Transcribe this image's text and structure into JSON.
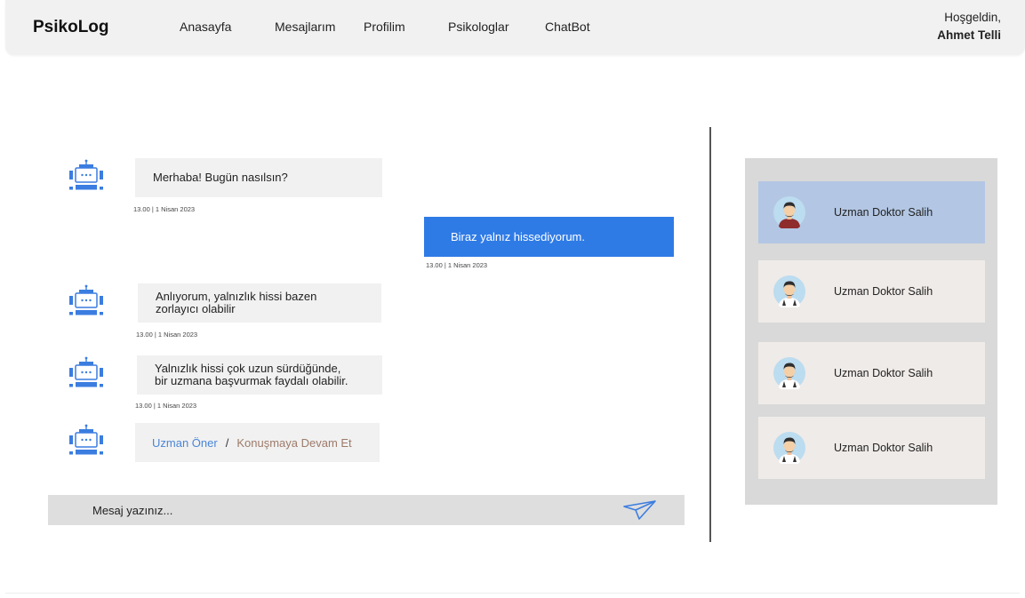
{
  "header": {
    "brand": "PsikoLog",
    "nav": [
      {
        "label": "Anasayfa"
      },
      {
        "label": "Mesajlarım"
      },
      {
        "label": "Profilim"
      },
      {
        "label": "Psikologlar"
      },
      {
        "label": "ChatBot"
      }
    ],
    "greeting": "Hoşgeldin,",
    "user_name": "Ahmet Telli"
  },
  "chat": {
    "messages": [
      {
        "sender": "bot",
        "text": "Merhaba! Bugün nasılsın?",
        "timestamp": "13.00 | 1 Nisan 2023"
      },
      {
        "sender": "user",
        "text": "Biraz yalnız hissediyorum.",
        "timestamp": "13.00 | 1 Nisan 2023"
      },
      {
        "sender": "bot",
        "text_line1": "Anlıyorum, yalnızlık hissi bazen",
        "text_line2": "zorlayıcı olabilir",
        "timestamp": "13.00 | 1 Nisan 2023"
      },
      {
        "sender": "bot",
        "text_line1": "Yalnızlık hissi çok uzun sürdüğünde,",
        "text_line2": "bir uzmana başvurmak faydalı olabilir.",
        "timestamp": "13.00 | 1 Nisan 2023"
      }
    ],
    "actions": {
      "suggest_expert": "Uzman Öner",
      "separator": "/",
      "continue": "Konuşmaya Devam Et"
    },
    "input": {
      "placeholder": "Mesaj yazınız...",
      "value": ""
    },
    "colors": {
      "user_bubble": "#2f7be6",
      "bot_bubble": "#f1f1f1",
      "bot_icon": "#3b7de0",
      "suggest_link": "#4a86d6",
      "continue_link": "#9d7a6a"
    }
  },
  "doctors": [
    {
      "name": "Uzman Doktor Salih",
      "selected": true
    },
    {
      "name": "Uzman Doktor Salih",
      "selected": false
    },
    {
      "name": "Uzman Doktor Salih",
      "selected": false
    },
    {
      "name": "Uzman Doktor Salih",
      "selected": false
    }
  ]
}
